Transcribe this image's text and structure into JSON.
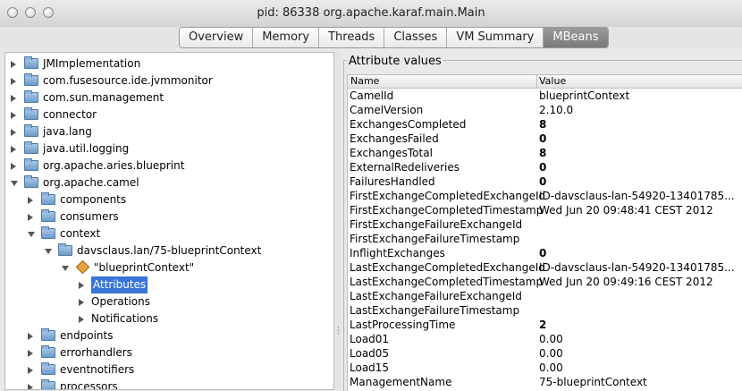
{
  "window": {
    "title": "pid: 86338 org.apache.karaf.main.Main"
  },
  "tabs": [
    {
      "label": "Overview",
      "active": false
    },
    {
      "label": "Memory",
      "active": false
    },
    {
      "label": "Threads",
      "active": false
    },
    {
      "label": "Classes",
      "active": false
    },
    {
      "label": "VM Summary",
      "active": false
    },
    {
      "label": "MBeans",
      "active": true
    }
  ],
  "tree": {
    "rows": [
      {
        "label": "JMImplementation",
        "depth": 0,
        "expanded": false,
        "icon": "folder-icon"
      },
      {
        "label": "com.fusesource.ide.jvmmonitor",
        "depth": 0,
        "expanded": false,
        "icon": "folder-icon"
      },
      {
        "label": "com.sun.management",
        "depth": 0,
        "expanded": false,
        "icon": "folder-icon"
      },
      {
        "label": "connector",
        "depth": 0,
        "expanded": false,
        "icon": "folder-icon"
      },
      {
        "label": "java.lang",
        "depth": 0,
        "expanded": false,
        "icon": "folder-icon"
      },
      {
        "label": "java.util.logging",
        "depth": 0,
        "expanded": false,
        "icon": "folder-icon"
      },
      {
        "label": "org.apache.aries.blueprint",
        "depth": 0,
        "expanded": false,
        "icon": "folder-icon"
      },
      {
        "label": "org.apache.camel",
        "depth": 0,
        "expanded": true,
        "icon": "folder-icon"
      },
      {
        "label": "components",
        "depth": 1,
        "expanded": false,
        "icon": "folder-icon"
      },
      {
        "label": "consumers",
        "depth": 1,
        "expanded": false,
        "icon": "folder-icon"
      },
      {
        "label": "context",
        "depth": 1,
        "expanded": true,
        "icon": "folder-icon"
      },
      {
        "label": "davsclaus.lan/75-blueprintContext",
        "depth": 2,
        "expanded": true,
        "icon": "folder-icon"
      },
      {
        "label": "\"blueprintContext\"",
        "depth": 3,
        "expanded": true,
        "icon": "bean-icon"
      },
      {
        "label": "Attributes",
        "depth": 4,
        "expanded": false,
        "icon": "none",
        "selected": true
      },
      {
        "label": "Operations",
        "depth": 4,
        "expanded": false,
        "icon": "none"
      },
      {
        "label": "Notifications",
        "depth": 4,
        "expanded": false,
        "icon": "none"
      },
      {
        "label": "endpoints",
        "depth": 1,
        "expanded": false,
        "icon": "folder-icon"
      },
      {
        "label": "errorhandlers",
        "depth": 1,
        "expanded": false,
        "icon": "folder-icon"
      },
      {
        "label": "eventnotifiers",
        "depth": 1,
        "expanded": false,
        "icon": "folder-icon"
      },
      {
        "label": "processors",
        "depth": 1,
        "expanded": false,
        "icon": "folder-icon"
      }
    ]
  },
  "attributes": {
    "group_title": "Attribute values",
    "columns": [
      "Name",
      "Value"
    ],
    "rows": [
      {
        "name": "CamelId",
        "value": "blueprintContext",
        "numeric": false
      },
      {
        "name": "CamelVersion",
        "value": "2.10.0",
        "numeric": false
      },
      {
        "name": "ExchangesCompleted",
        "value": "8",
        "numeric": true
      },
      {
        "name": "ExchangesFailed",
        "value": "0",
        "numeric": true
      },
      {
        "name": "ExchangesTotal",
        "value": "8",
        "numeric": true
      },
      {
        "name": "ExternalRedeliveries",
        "value": "0",
        "numeric": true
      },
      {
        "name": "FailuresHandled",
        "value": "0",
        "numeric": true
      },
      {
        "name": "FirstExchangeCompletedExchangeId",
        "value": "ID-davsclaus-lan-54920-13401785...",
        "numeric": false
      },
      {
        "name": "FirstExchangeCompletedTimestamp",
        "value": "Wed Jun 20 09:48:41 CEST 2012",
        "numeric": false
      },
      {
        "name": "FirstExchangeFailureExchangeId",
        "value": "",
        "numeric": false
      },
      {
        "name": "FirstExchangeFailureTimestamp",
        "value": "",
        "numeric": false
      },
      {
        "name": "InflightExchanges",
        "value": "0",
        "numeric": true
      },
      {
        "name": "LastExchangeCompletedExchangeId",
        "value": "ID-davsclaus-lan-54920-13401785...",
        "numeric": false
      },
      {
        "name": "LastExchangeCompletedTimestamp",
        "value": "Wed Jun 20 09:49:16 CEST 2012",
        "numeric": false
      },
      {
        "name": "LastExchangeFailureExchangeId",
        "value": "",
        "numeric": false
      },
      {
        "name": "LastExchangeFailureTimestamp",
        "value": "",
        "numeric": false
      },
      {
        "name": "LastProcessingTime",
        "value": "2",
        "numeric": true
      },
      {
        "name": "Load01",
        "value": "0.00",
        "numeric": false
      },
      {
        "name": "Load05",
        "value": "0.00",
        "numeric": false
      },
      {
        "name": "Load15",
        "value": "0.00",
        "numeric": false
      },
      {
        "name": "ManagementName",
        "value": "75-blueprintContext",
        "numeric": false
      }
    ]
  },
  "colors": {
    "selection": "#3875d7",
    "active_tab": "#8a8a8a"
  }
}
